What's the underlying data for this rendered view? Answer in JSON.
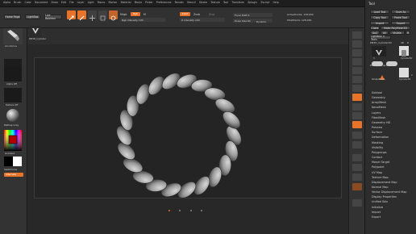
{
  "menu": [
    "Alpha",
    "Brush",
    "Color",
    "Document",
    "Draw",
    "Edit",
    "File",
    "Layer",
    "Light",
    "Macro",
    "Marker",
    "Material",
    "Movie",
    "Picker",
    "Preferences",
    "Render",
    "Stencil",
    "Stroke",
    "Texture",
    "Tool",
    "Transform",
    "Zplugin",
    "Zscript",
    "Help"
  ],
  "toolbar": {
    "home_page": "Home Page",
    "lightbox": "LightBox",
    "live_boolean": "Live Boolean",
    "mrgb": "Mrgb",
    "rgb": "Rgb",
    "m": "M",
    "rgb_intensity": "Rgb Intensity 100",
    "zadd": "Zadd",
    "zsub": "Zsub",
    "zcut": "Zcut",
    "z_intensity": "Z Intensity 100",
    "focal_shift": "Focal Shift 0",
    "draw_size": "Draw Size 64",
    "dynamic": "Dynamic",
    "active_points": "ActivePoints: 128,000",
    "total_points": "TotalPoints: 128,000"
  },
  "left": {
    "brush_label": "AccuCurve",
    "alpha_label": "Alpha Off",
    "texture_label": "Texture Off",
    "material_label": "MatCap Gray",
    "gradient": "Gradient",
    "switch_color": "SwitchColor",
    "alternate": "Alternate",
    "pm3d_label": "PM3D_Cylinder"
  },
  "right_shelf": [
    "BPR",
    "SPix 3",
    "Scroll",
    "Zoom",
    "Actual",
    "AAHalf",
    "Persp",
    "Floor",
    "L.Sym",
    "Frame",
    "Move",
    "Scale",
    "Rotate",
    "PolyF",
    "Transp",
    "Solo",
    "Xpose"
  ],
  "tool_panel": {
    "title": "Tool",
    "load_tool": "Load Tool",
    "save_as": "Save As",
    "copy_tool": "Copy Tool",
    "paste_tool": "Paste Tool",
    "import": "Import",
    "export": "Export",
    "clone": "Clone",
    "make_polymesh": "Make PolyMesh3D",
    "goz": "GoZ",
    "all": "All",
    "visible": "Visible",
    "r": "R",
    "lightbox_tools": "Lightbox > Tools",
    "current_tool": "PM3D_Cylinder3D",
    "count": "48",
    "r_label": "R",
    "items": [
      "PM3D_Cylinder3D",
      "Cylinder3D",
      "PM3D_Cylinder3D",
      "SimpleBrush",
      "Cylinder3D"
    ],
    "numbers": [
      "3",
      "2"
    ]
  },
  "tool_subpalettes": [
    "Subtool",
    "Geometry",
    "ArrayMesh",
    "NanoMesh",
    "Layers",
    "FiberMesh",
    "Geometry HD",
    "Preview",
    "Surface",
    "Deformation",
    "Masking",
    "Visibility",
    "Polygroups",
    "Contact",
    "Morph Target",
    "Polypaint",
    "UV Map",
    "Texture Map",
    "Displacement Map",
    "Normal Map",
    "Vector Displacement Map",
    "Display Properties",
    "Unified Skin",
    "Initialize",
    "Import",
    "Export"
  ]
}
